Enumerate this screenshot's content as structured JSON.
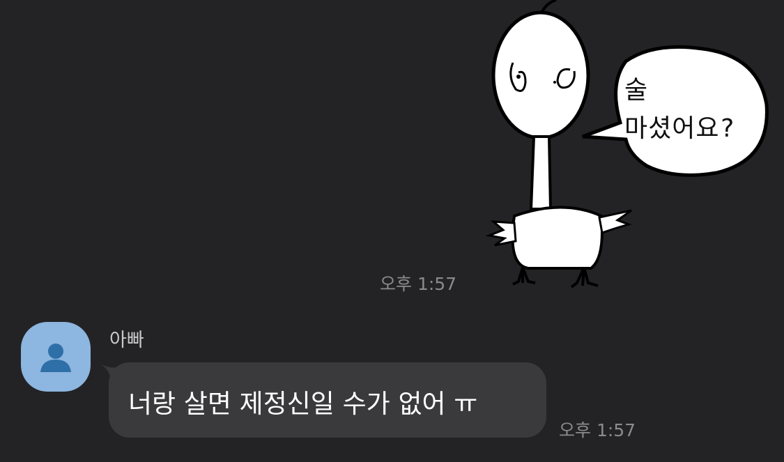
{
  "chat": {
    "outgoing": {
      "sticker": {
        "speech_line1": "술",
        "speech_line2": "마셨어요?"
      },
      "time": "오후 1:57"
    },
    "incoming": {
      "sender": "아빠",
      "avatar_icon": "person-icon",
      "message": "너랑 살면 제정신일 수가 없어 ㅠ",
      "time": "오후 1:57"
    }
  },
  "colors": {
    "background": "#232325",
    "bubble": "#3a3a3c",
    "avatar": "#8db6e0",
    "timestamp": "#8b8b8f"
  }
}
